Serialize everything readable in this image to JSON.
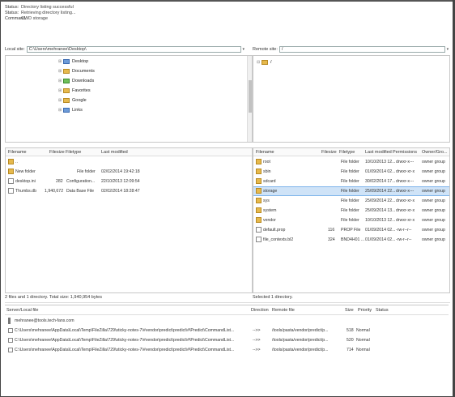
{
  "log": [
    {
      "k": "Status:",
      "v": "Directory listing successful"
    },
    {
      "k": "Status:",
      "v": "Retrieving directory listing..."
    },
    {
      "k": "Command:",
      "v": "CWD storage"
    }
  ],
  "local_site": {
    "label": "Local site:",
    "path": "C:\\Users\\mehranee\\Desktop\\"
  },
  "remote_site": {
    "label": "Remote site:",
    "path": "/"
  },
  "local_tree": [
    "Desktop",
    "Documents",
    "Downloads",
    "Favorites",
    "Google",
    "Links"
  ],
  "remote_tree": [
    "/"
  ],
  "local_columns": [
    "Filename",
    "Filesize",
    "Filetype",
    "Last modified"
  ],
  "local_files": [
    {
      "name": "..",
      "size": "",
      "type": "",
      "modified": ""
    },
    {
      "name": "New folder",
      "size": "",
      "type": "File folder",
      "modified": "02/02/2014 19:42:18"
    },
    {
      "name": "desktop.ini",
      "size": "282",
      "type": "Configuration...",
      "modified": "22/10/2013 12:09:54"
    },
    {
      "name": "Thumbs.db",
      "size": "1,940,672",
      "type": "Data Base File",
      "modified": "02/02/2014 18:28:47"
    }
  ],
  "remote_columns": [
    "Filename",
    "Filesize",
    "Filetype",
    "Last modified",
    "Permissions",
    "Owner/Gro..."
  ],
  "remote_files": [
    {
      "name": "root",
      "size": "",
      "type": "File folder",
      "modified": "10/10/2013 12...",
      "perm": "drwxr-x---",
      "owner": "owner group"
    },
    {
      "name": "sbin",
      "size": "",
      "type": "File folder",
      "modified": "01/09/2014 02...",
      "perm": "drwxr-xr-x",
      "owner": "owner group"
    },
    {
      "name": "sdcard",
      "size": "",
      "type": "File folder",
      "modified": "30/02/2014 17...",
      "perm": "drwxr-x---",
      "owner": "owner group"
    },
    {
      "name": "storage",
      "size": "",
      "type": "File folder",
      "modified": "25/09/2014 22...",
      "perm": "drwxr-x---",
      "owner": "owner group",
      "selected": true
    },
    {
      "name": "sys",
      "size": "",
      "type": "File folder",
      "modified": "25/09/2014 22...",
      "perm": "drwxr-xr-x",
      "owner": "owner group"
    },
    {
      "name": "system",
      "size": "",
      "type": "File folder",
      "modified": "25/09/2014 13...",
      "perm": "drwxr-xr-x",
      "owner": "owner group"
    },
    {
      "name": "vendor",
      "size": "",
      "type": "File folder",
      "modified": "10/10/2013 12...",
      "perm": "drwxr-xr-x",
      "owner": "owner group"
    },
    {
      "name": "default.prop",
      "size": "116",
      "type": "PROP File",
      "modified": "01/09/2014 02...",
      "perm": "-rw-r--r--",
      "owner": "owner group"
    },
    {
      "name": "file_contexts.bl2",
      "size": "324",
      "type": "BND4H01 ...",
      "modified": "01/09/2014 02...",
      "perm": "-rw-r--r--",
      "owner": "owner group"
    }
  ],
  "local_status": "2 files and 1 directory. Total size: 1,940,954 bytes",
  "remote_status": "Selected 1 directory.",
  "queue_columns": [
    "Server/Local file",
    "Direction",
    "Remote file",
    "Size",
    "Priority",
    "Status"
  ],
  "queue_server": "mehranee@tools.tech-fans.com",
  "queue_rows": [
    {
      "local": "C:\\Users\\mehranee\\AppData\\Local\\Temp\\FileZilla\\729\\sticky-notes-7\\#vendor\\predict\\predict\\#\\Predict\\CommandList...",
      "dir": "-->>",
      "remote": "/tools/pasta/vendor/predict/p...",
      "size": "518",
      "priority": "Normal"
    },
    {
      "local": "C:\\Users\\mehranee\\AppData\\Local\\Temp\\FileZilla\\729\\sticky-notes-7\\#vendor\\predict\\predict\\#\\Predict\\CommandList...",
      "dir": "-->>",
      "remote": "/tools/pasta/vendor/predict/p...",
      "size": "520",
      "priority": "Normal"
    },
    {
      "local": "C:\\Users\\mehranee\\AppData\\Local\\Temp\\FileZilla\\729\\sticky-notes-7\\#vendor\\predict\\predict\\#\\Predict\\CommandList...",
      "dir": "-->>",
      "remote": "/tools/pasta/vendor/predict/p...",
      "size": "714",
      "priority": "Normal"
    }
  ],
  "colors": {
    "folder": "#e6b94c",
    "selection": "#cfe3f7"
  }
}
